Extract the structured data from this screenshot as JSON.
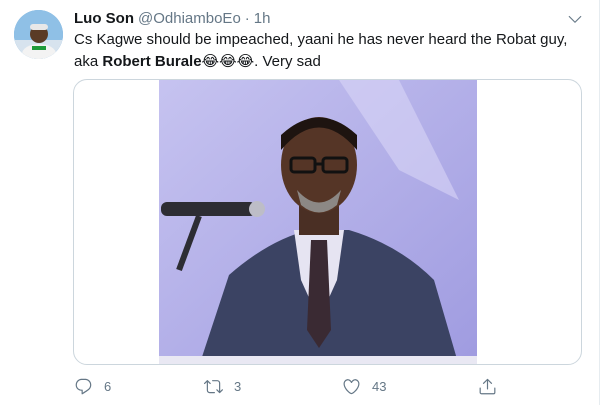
{
  "tweet": {
    "author_name": "Luo Son",
    "author_handle": "@OdhiamboEo",
    "separator": "·",
    "time": "1h",
    "text_line1": "Cs Kagwe should be impeached,  yaani he has never heard the Robat guy,",
    "text_pre": "aka ",
    "text_bold": "Robert Burale",
    "text_emojis": "😂😂😂",
    "text_post": ". Very sad",
    "icons": {
      "more": "chevron-down-icon",
      "reply": "reply-icon",
      "retweet": "retweet-icon",
      "like": "heart-icon",
      "share": "share-icon"
    },
    "stats": {
      "replies": "6",
      "retweets": "3",
      "likes": "43"
    },
    "colors": {
      "text": "#14171a",
      "secondary": "#657786",
      "border": "#ccd6dd",
      "photo_background": "#b7b4ea"
    }
  }
}
